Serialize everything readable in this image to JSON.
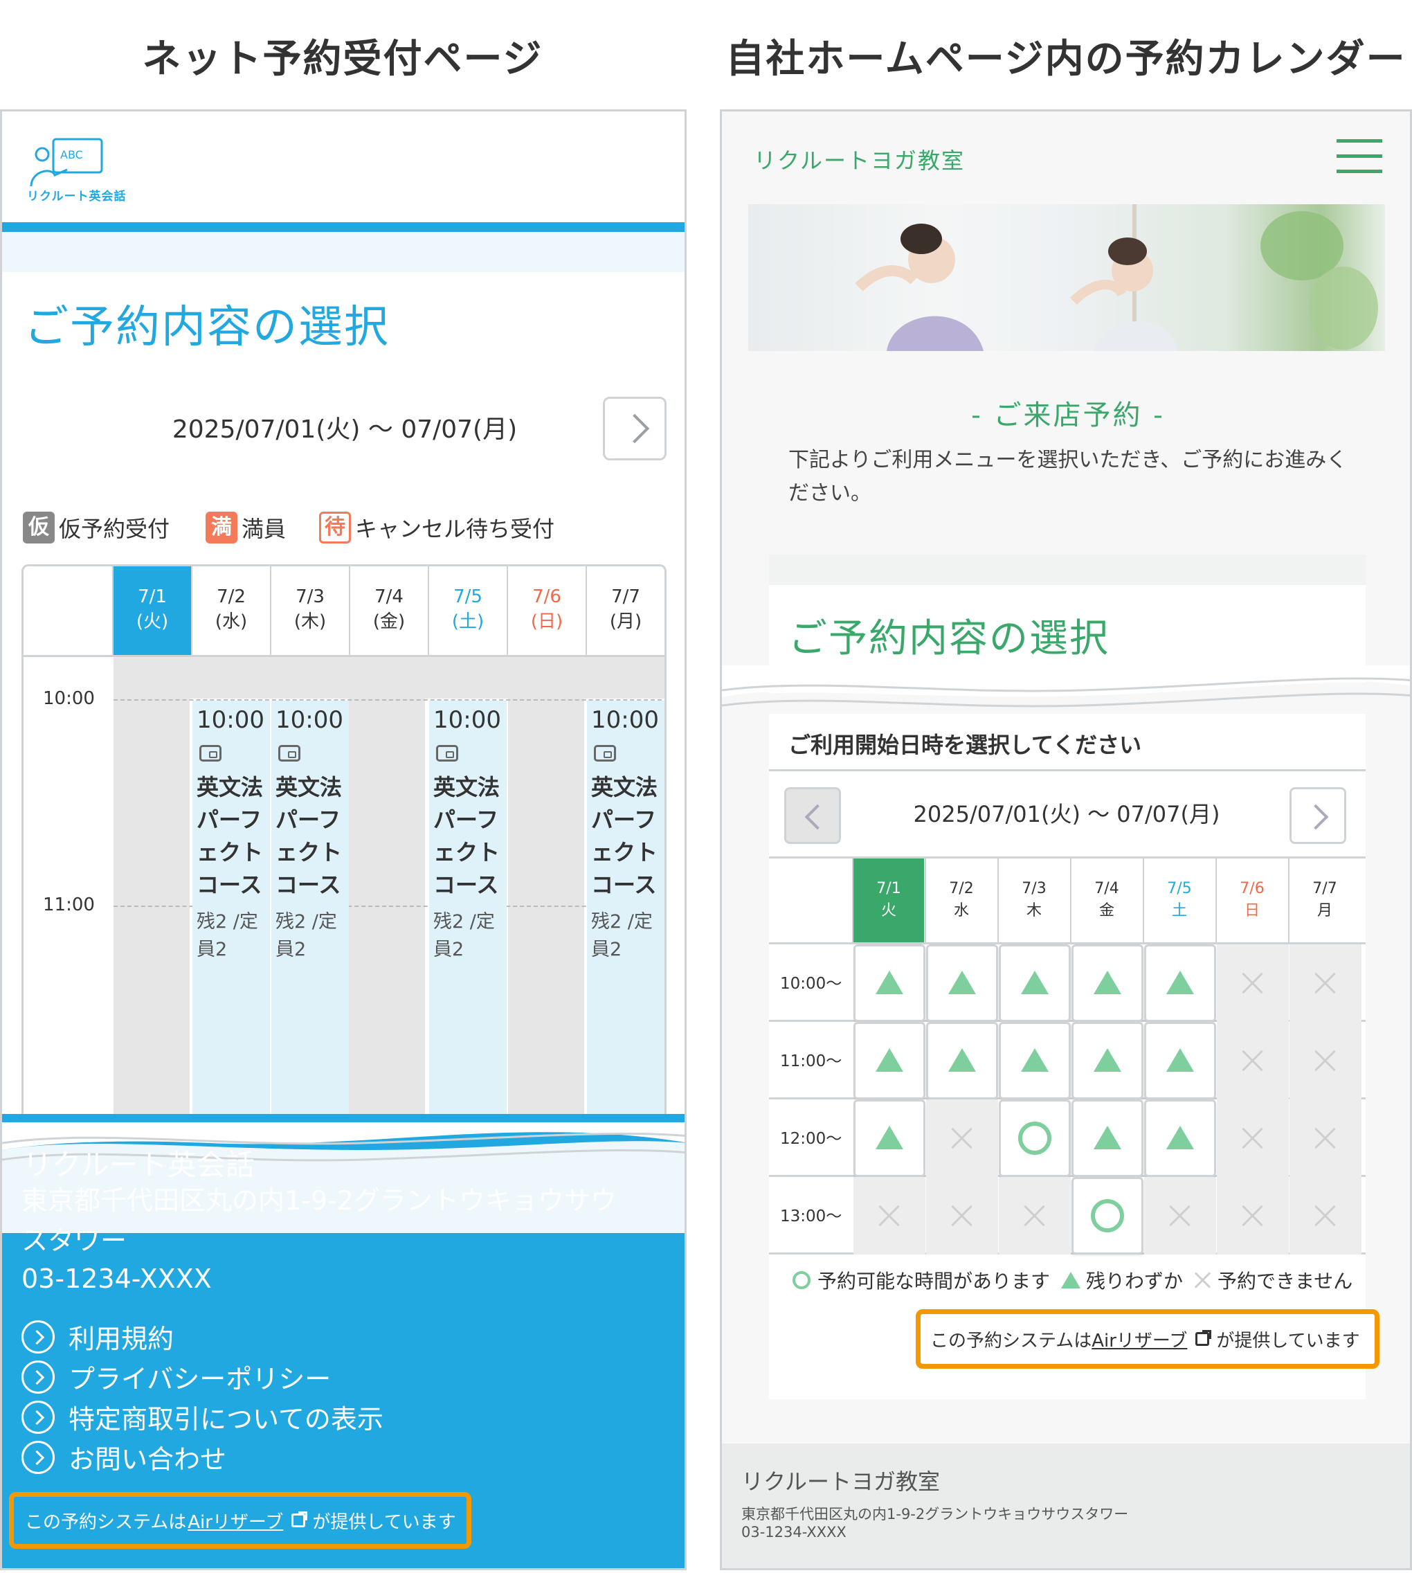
{
  "titles": {
    "left": "ネット予約受付ページ",
    "right": "自社ホームページ内の予約カレンダー"
  },
  "left": {
    "logo_text": "リクルート英会話",
    "logo_board": "ABC",
    "heading": "ご予約内容の選択",
    "date_range": "2025/07/01(火) 〜 07/07(月)",
    "legend": [
      {
        "badge": "仮",
        "label": "仮予約受付",
        "color": "#888888"
      },
      {
        "badge": "満",
        "label": "満員",
        "color": "#f47a5a"
      },
      {
        "badge": "待",
        "label": "キャンセル待ち受付",
        "color": "#f47a5a"
      }
    ],
    "days": [
      {
        "date": "7/1",
        "dow": "(火)",
        "state": "selected"
      },
      {
        "date": "7/2",
        "dow": "(水)",
        "state": "weekday"
      },
      {
        "date": "7/3",
        "dow": "(木)",
        "state": "weekday"
      },
      {
        "date": "7/4",
        "dow": "(金)",
        "state": "weekday"
      },
      {
        "date": "7/5",
        "dow": "(土)",
        "state": "saturday"
      },
      {
        "date": "7/6",
        "dow": "(日)",
        "state": "sunday"
      },
      {
        "date": "7/7",
        "dow": "(月)",
        "state": "weekday"
      }
    ],
    "times": [
      "10:00",
      "11:00"
    ],
    "slots": [
      {
        "day": "7/2",
        "time": "10:00",
        "name": "英文法パーフェクトコース",
        "remaining": "残2 /定員2"
      },
      {
        "day": "7/3",
        "time": "10:00",
        "name": "英文法パーフェクトコース",
        "remaining": "残2 /定員2"
      },
      {
        "day": "7/5",
        "time": "10:00",
        "name": "英文法パーフェクトコース",
        "remaining": "残2 /定員2"
      },
      {
        "day": "7/7",
        "time": "10:00",
        "name": "英文法パーフェクトコース",
        "remaining": "残2 /定員2"
      }
    ],
    "footer": {
      "name": "リクルート英会話",
      "address": "東京都千代田区丸の内1-9-2グラントウキョウサウスタワー",
      "tel": "03-1234-XXXX",
      "links": [
        "利用規約",
        "プライバシーポリシー",
        "特定商取引についての表示",
        "お問い合わせ"
      ],
      "powered_pre": "この予約システムは",
      "powered_link": "Airリザーブ",
      "powered_post": "が提供しています"
    },
    "accent_color": "#22a8e0"
  },
  "right": {
    "brand": "リクルートヨガ教室",
    "subtitle": "- ご来店予約 -",
    "intro": "下記よりご利用メニューを選択いただき、ご予約にお進みください。",
    "heading": "ご予約内容の選択",
    "prompt": "ご利用開始日時を選択してください",
    "date_range": "2025/07/01(火) 〜 07/07(月)",
    "days": [
      {
        "date": "7/1",
        "dow": "火",
        "state": "selected"
      },
      {
        "date": "7/2",
        "dow": "水",
        "state": "weekday"
      },
      {
        "date": "7/3",
        "dow": "木",
        "state": "weekday"
      },
      {
        "date": "7/4",
        "dow": "金",
        "state": "weekday"
      },
      {
        "date": "7/5",
        "dow": "土",
        "state": "saturday"
      },
      {
        "date": "7/6",
        "dow": "日",
        "state": "sunday"
      },
      {
        "date": "7/7",
        "dow": "月",
        "state": "weekday"
      }
    ],
    "rows": [
      {
        "time": "10:00〜",
        "cells": [
          "few",
          "few",
          "few",
          "few",
          "few",
          "none",
          "none"
        ]
      },
      {
        "time": "11:00〜",
        "cells": [
          "few",
          "few",
          "few",
          "few",
          "few",
          "none",
          "none"
        ]
      },
      {
        "time": "12:00〜",
        "cells": [
          "few",
          "none",
          "open",
          "few",
          "few",
          "none",
          "none"
        ]
      },
      {
        "time": "13:00〜",
        "cells": [
          "none",
          "none",
          "none",
          "open",
          "none",
          "none",
          "none"
        ]
      }
    ],
    "legend": {
      "open": "予約可能な時間があります",
      "few": "残りわずか",
      "none": "予約できません"
    },
    "powered_pre": "この予約システムは",
    "powered_link": "Airリザーブ",
    "powered_post": "が提供しています",
    "footer": {
      "name": "リクルートヨガ教室",
      "address": "東京都千代田区丸の内1-9-2グラントウキョウサウスタワー",
      "tel": "03-1234-XXXX"
    },
    "accent_color": "#3aa86a",
    "mark_color": "#7fcf9e",
    "highlight_color": "#f39800"
  }
}
